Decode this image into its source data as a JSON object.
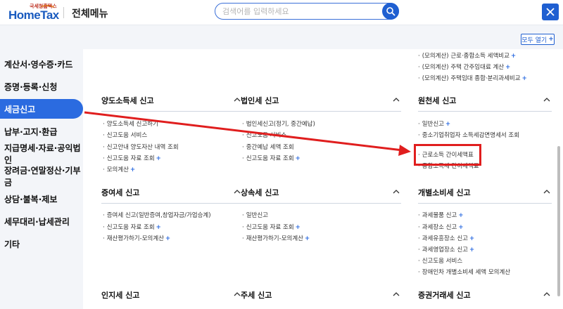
{
  "header": {
    "logo_small": "국세청홈택스",
    "logo_main": "HomeTax",
    "title": "전체메뉴",
    "search_placeholder": "검색어를 입력하세요",
    "search_icon": "search-icon",
    "close_icon": "close-icon"
  },
  "toolbar": {
    "expand_all_label": "모두 열기",
    "expand_all_plus": "+"
  },
  "sidebar": {
    "items": [
      {
        "label": "계산서·영수증·카드",
        "active": false
      },
      {
        "label": "증명·등록·신청",
        "active": false
      },
      {
        "label": "세금신고",
        "active": true
      },
      {
        "label": "납부·고지·환급",
        "active": false
      },
      {
        "label": "지급명세·자료·공익법인",
        "active": false
      },
      {
        "label": "장려금·연말정산·기부금",
        "active": false
      },
      {
        "label": "상담·불복·제보",
        "active": false
      },
      {
        "label": "세무대리·납세관리",
        "active": false
      },
      {
        "label": "기타",
        "active": false
      }
    ]
  },
  "top_links": [
    {
      "text": "(모의계산) 근로·종합소득 세액비교",
      "plus": true
    },
    {
      "text": "(모의계산) 주택 간주임대료 계산",
      "plus": true
    },
    {
      "text": "(모의계산) 주택임대 종합·분리과세비교",
      "plus": true
    }
  ],
  "sections": {
    "transfer": {
      "title": "양도소득세 신고",
      "items": [
        {
          "text": "양도소득세 신고하기",
          "plus": false
        },
        {
          "text": "신고도움 서비스",
          "plus": false
        },
        {
          "text": "신고안내 양도자산 내역 조회",
          "plus": false
        },
        {
          "text": "신고도움 자료 조회",
          "plus": true
        },
        {
          "text": "모의계산",
          "plus": true
        }
      ]
    },
    "corporate": {
      "title": "법인세 신고",
      "items": [
        {
          "text": "법인세신고(정기, 중간예납)",
          "plus": false
        },
        {
          "text": "신고도움 서비스",
          "plus": false
        },
        {
          "text": "중간예납 세액 조회",
          "plus": false
        },
        {
          "text": "신고도움 자료 조회",
          "plus": true
        }
      ]
    },
    "withholding": {
      "title": "원천세 신고",
      "items": [
        {
          "text": "일반신고",
          "plus": true
        },
        {
          "text": "중소기업취업자 소득세감면명세서 조회",
          "plus": false
        },
        {
          "text": "근로소득 간이세액표",
          "plus": false
        },
        {
          "text": "종합소득세 간이세액표",
          "plus": false
        }
      ]
    },
    "gift": {
      "title": "증여세 신고",
      "items": [
        {
          "text": "증여세 신고(일반증여,창업자금/가업승계)",
          "plus": false
        },
        {
          "text": "신고도움 자료 조회",
          "plus": true
        },
        {
          "text": "재산평가하기-모의계산",
          "plus": true
        }
      ]
    },
    "inheritance": {
      "title": "상속세 신고",
      "items": [
        {
          "text": "일반신고",
          "plus": false
        },
        {
          "text": "신고도움 자료 조회",
          "plus": true
        },
        {
          "text": "재산평가하기-모의계산",
          "plus": true
        }
      ]
    },
    "excise": {
      "title": "개별소비세 신고",
      "items": [
        {
          "text": "과세물품 신고",
          "plus": true
        },
        {
          "text": "과세장소 신고",
          "plus": true
        },
        {
          "text": "과세유흥장소 신고",
          "plus": true
        },
        {
          "text": "과세영업장소 신고",
          "plus": true
        },
        {
          "text": "신고도움 서비스",
          "plus": false
        },
        {
          "text": "장애인차 개별소비세 세액 모의계산",
          "plus": false
        }
      ]
    },
    "stamp": {
      "title": "인지세 신고"
    },
    "liquor": {
      "title": "주세 신고"
    },
    "securities": {
      "title": "증권거래세 신고"
    }
  },
  "colors": {
    "accent": "#2b6be0",
    "annotation": "#e01e1e"
  }
}
